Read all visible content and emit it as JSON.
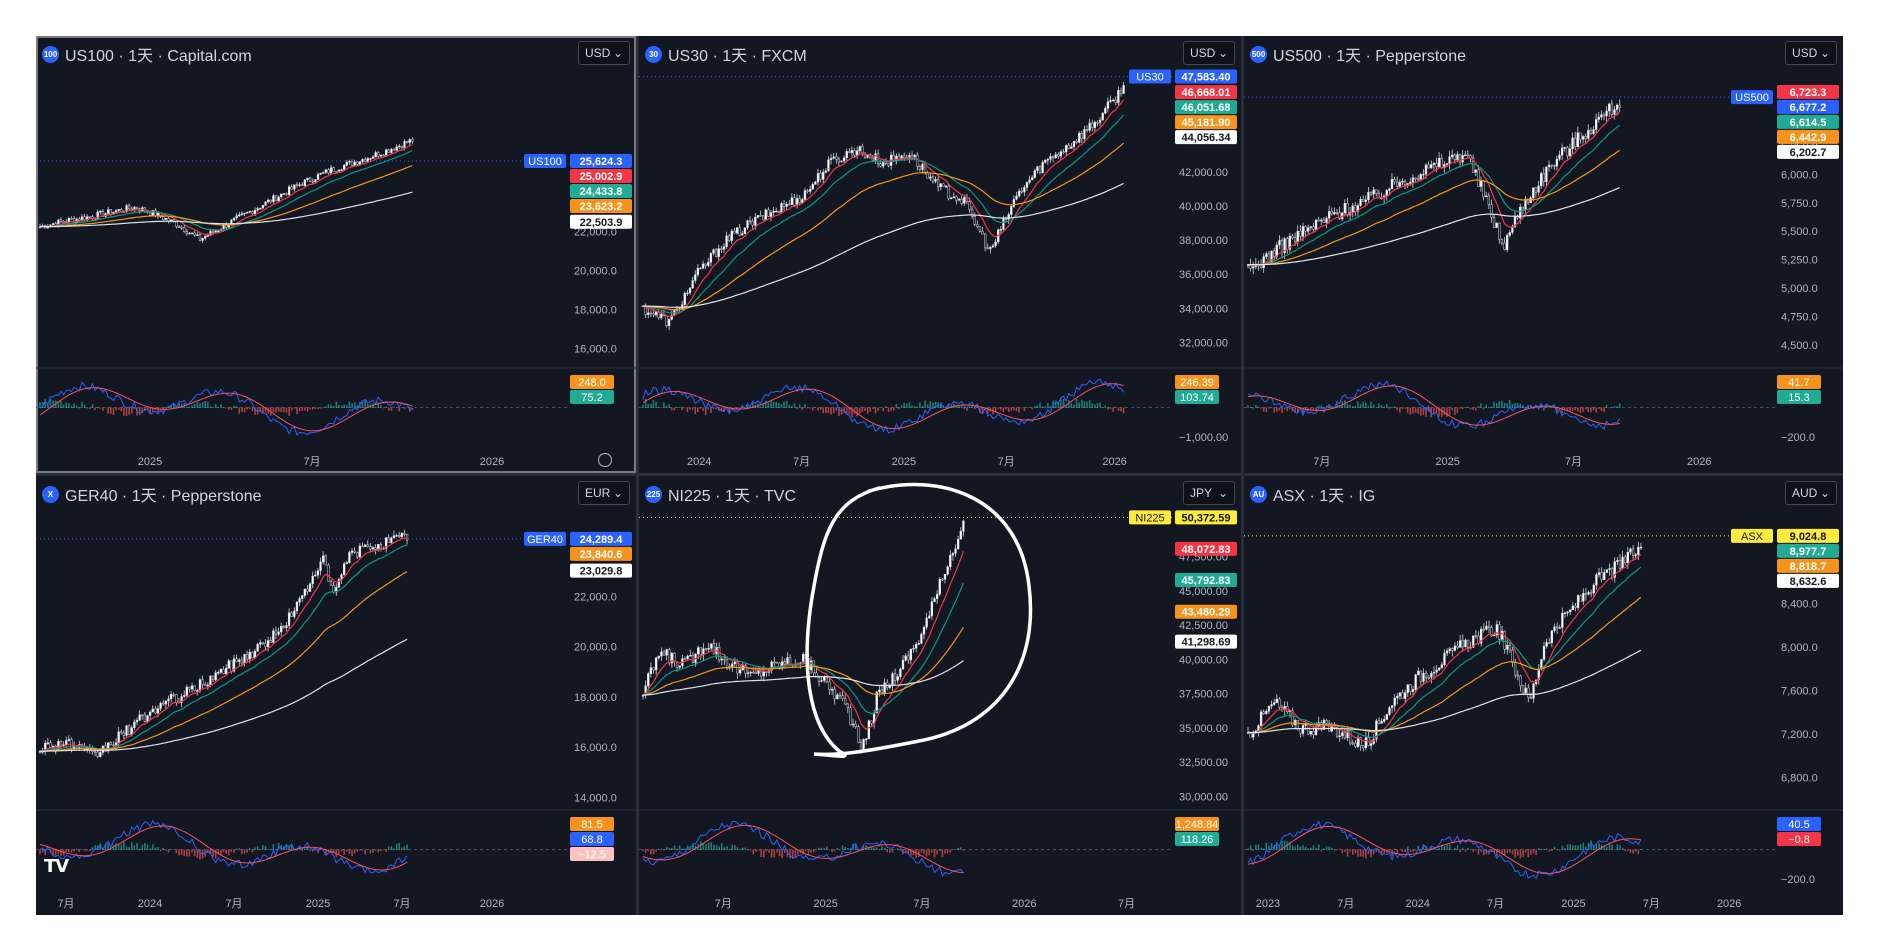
{
  "colors": {
    "background": "#131722",
    "candle": "#d1d4dc",
    "ema_fast": "#f23645",
    "ema_mid": "#089981",
    "ema_slow": "#f7931a",
    "ema_long": "#e0e3eb",
    "grid": "#2a2e39",
    "text": "#b2b5be",
    "macd": "#2962ff",
    "signal": "#f7525f"
  },
  "watermark": "TV",
  "chart_data": [
    {
      "id": "us100",
      "type": "line",
      "title": "US100 · 1天 · Capital.com",
      "icon": "100",
      "currency": "USD",
      "ylim": [
        15000,
        30500
      ],
      "yticks": [
        "16,000.0",
        "18,000.0",
        "20,000.0",
        "22,000.0"
      ],
      "ytick_values": [
        16000,
        18000,
        20000,
        22000
      ],
      "xticks": [
        "2025",
        "7月",
        "2026"
      ],
      "xtick_pos": [
        0.19,
        0.46,
        0.76
      ],
      "symbol_badge": "US100",
      "price_labels": [
        {
          "text": "25,624.3",
          "value": 25624.3,
          "color": "#2962ff",
          "fg": "#ffffff"
        },
        {
          "text": "25,002.9",
          "value": 25002.9,
          "color": "#f23645",
          "fg": "#ffffff"
        },
        {
          "text": "24,433.8",
          "value": 24433.8,
          "color": "#22ab94",
          "fg": "#ffffff"
        },
        {
          "text": "23,623.2",
          "value": 23623.2,
          "color": "#f7931a",
          "fg": "#ffffff"
        },
        {
          "text": "22,503.9",
          "value": 22503.9,
          "color": "#ffffff",
          "fg": "#131722"
        }
      ],
      "osc_labels": [
        {
          "text": "248.0",
          "color": "#f7931a"
        },
        {
          "text": "75.2",
          "color": "#22ab94"
        }
      ],
      "osc_ticks": [],
      "keypoints": [
        [
          0,
          0.52
        ],
        [
          0.05,
          0.62
        ],
        [
          0.1,
          0.7
        ],
        [
          0.14,
          0.78
        ],
        [
          0.18,
          0.85
        ],
        [
          0.22,
          0.72
        ],
        [
          0.26,
          0.55
        ],
        [
          0.3,
          0.3
        ],
        [
          0.34,
          0.5
        ],
        [
          0.38,
          0.7
        ],
        [
          0.43,
          0.95
        ],
        [
          0.49,
          1.25
        ],
        [
          0.55,
          1.5
        ],
        [
          0.61,
          1.68
        ],
        [
          0.66,
          1.85
        ],
        [
          0.7,
          2.0
        ]
      ],
      "xmax": 0.7,
      "start": 20700,
      "scale": 3000
    },
    {
      "id": "us30",
      "type": "line",
      "title": "US30 · 1天 · FXCM",
      "icon": "30",
      "currency": "USD",
      "ylim": [
        30500,
        48200
      ],
      "yticks": [
        "32,000.00",
        "34,000.00",
        "36,000.00",
        "38,000.00",
        "40,000.00",
        "42,000.00",
        "44,056.34"
      ],
      "ytick_values": [
        32000,
        34000,
        36000,
        38000,
        40000,
        42000
      ],
      "xticks": [
        "2024",
        "7月",
        "2025",
        "7月",
        "2026"
      ],
      "xtick_pos": [
        0.1,
        0.27,
        0.44,
        0.61,
        0.79
      ],
      "symbol_badge": "US30",
      "price_labels": [
        {
          "text": "47,583.40",
          "value": 47583.4,
          "color": "#2962ff",
          "fg": "#ffffff"
        },
        {
          "text": "46,668.01",
          "value": 46668.01,
          "color": "#f23645",
          "fg": "#ffffff"
        },
        {
          "text": "46,051.68",
          "value": 46051.68,
          "color": "#22ab94",
          "fg": "#ffffff"
        },
        {
          "text": "45,181.90",
          "value": 45181.9,
          "color": "#f7931a",
          "fg": "#ffffff"
        },
        {
          "text": "44,056.34",
          "value": 44056.34,
          "color": "#ffffff",
          "fg": "#131722"
        }
      ],
      "osc_labels": [
        {
          "text": "246.39",
          "color": "#f7931a"
        },
        {
          "text": "103.74",
          "color": "#22ab94"
        }
      ],
      "osc_ticks": [
        "−1,000.00"
      ],
      "keypoints": [
        [
          0,
          0
        ],
        [
          0.05,
          -0.15
        ],
        [
          0.1,
          0.35
        ],
        [
          0.15,
          0.7
        ],
        [
          0.2,
          0.9
        ],
        [
          0.25,
          1.05
        ],
        [
          0.3,
          1.2
        ],
        [
          0.35,
          1.55
        ],
        [
          0.4,
          1.7
        ],
        [
          0.45,
          1.55
        ],
        [
          0.5,
          1.65
        ],
        [
          0.55,
          1.3
        ],
        [
          0.6,
          1.15
        ],
        [
          0.65,
          0.6
        ],
        [
          0.7,
          1.2
        ],
        [
          0.75,
          1.55
        ],
        [
          0.8,
          1.75
        ],
        [
          0.85,
          2.0
        ],
        [
          0.9,
          2.35
        ]
      ],
      "xmax": 0.9,
      "start": 34000,
      "scale": 5500
    },
    {
      "id": "us500",
      "type": "line",
      "title": "US500 · 1天 · Pepperstone",
      "icon": "500",
      "currency": "USD",
      "ylim": [
        4300,
        6950
      ],
      "yticks": [
        "4,500.0",
        "4,750.0",
        "5,000.0",
        "5,250.0",
        "5,500.0",
        "5,750.0",
        "6,000.0",
        "6,250.0"
      ],
      "ytick_values": [
        4500,
        4750,
        5000,
        5250,
        5500,
        5750,
        6000,
        6250
      ],
      "xticks": [
        "7月",
        "2025",
        "7月",
        "2026"
      ],
      "xtick_pos": [
        0.13,
        0.34,
        0.55,
        0.76
      ],
      "symbol_badge": "US500",
      "price_labels": [
        {
          "text": "6,677.2",
          "value": 6677.2,
          "color": "#2962ff",
          "fg": "#ffffff"
        },
        {
          "text": "6,723.3",
          "value": 6723.3,
          "color": "#f23645",
          "fg": "#ffffff"
        },
        {
          "text": "6,614.5",
          "value": 6614.5,
          "color": "#22ab94",
          "fg": "#ffffff"
        },
        {
          "text": "6,442.9",
          "value": 6442.9,
          "color": "#f7931a",
          "fg": "#ffffff"
        },
        {
          "text": "6,202.7",
          "value": 6202.7,
          "color": "#ffffff",
          "fg": "#131722"
        }
      ],
      "osc_labels": [
        {
          "text": "41.7",
          "color": "#f7931a"
        },
        {
          "text": "15.3",
          "color": "#22ab94"
        }
      ],
      "osc_ticks": [
        "−200.0"
      ],
      "keypoints": [
        [
          0,
          0
        ],
        [
          0.08,
          0.25
        ],
        [
          0.16,
          0.45
        ],
        [
          0.24,
          0.6
        ],
        [
          0.3,
          0.75
        ],
        [
          0.36,
          0.85
        ],
        [
          0.41,
          0.95
        ],
        [
          0.45,
          0.55
        ],
        [
          0.48,
          0.2
        ],
        [
          0.52,
          0.55
        ],
        [
          0.57,
          0.85
        ],
        [
          0.62,
          1.05
        ],
        [
          0.67,
          1.25
        ],
        [
          0.7,
          1.35
        ]
      ],
      "xmax": 0.7,
      "start": 5150,
      "scale": 1100
    },
    {
      "id": "ger40",
      "type": "line",
      "title": "GER40 · 1天 · Pepperstone",
      "icon": "X",
      "currency": "EUR",
      "ylim": [
        13500,
        25600
      ],
      "yticks": [
        "14,000.0",
        "16,000.0",
        "18,000.0",
        "20,000.0",
        "22,000.0"
      ],
      "ytick_values": [
        14000,
        16000,
        18000,
        20000,
        22000
      ],
      "xticks": [
        "7月",
        "2024",
        "7月",
        "2025",
        "7月",
        "2026"
      ],
      "xtick_pos": [
        0.05,
        0.19,
        0.33,
        0.47,
        0.61,
        0.76
      ],
      "symbol_badge": "GER40",
      "price_labels": [
        {
          "text": "24,289.4",
          "value": 24289.4,
          "color": "#2962ff",
          "fg": "#ffffff"
        },
        {
          "text": "23,840.6",
          "value": 23840.6,
          "color": "#f7931a",
          "fg": "#ffffff"
        },
        {
          "text": "23,029.8",
          "value": 23029.8,
          "color": "#ffffff",
          "fg": "#131722"
        }
      ],
      "osc_labels": [
        {
          "text": "81.5",
          "color": "#f7931a"
        },
        {
          "text": "68.8",
          "color": "#2962ff"
        },
        {
          "text": "−12.5",
          "color": "#fbc2c2"
        }
      ],
      "osc_ticks": [],
      "keypoints": [
        [
          0,
          0
        ],
        [
          0.05,
          0.05
        ],
        [
          0.1,
          -0.1
        ],
        [
          0.16,
          0.15
        ],
        [
          0.22,
          0.4
        ],
        [
          0.28,
          0.55
        ],
        [
          0.34,
          0.75
        ],
        [
          0.4,
          0.95
        ],
        [
          0.45,
          1.15
        ],
        [
          0.5,
          1.55
        ],
        [
          0.53,
          1.9
        ],
        [
          0.55,
          1.5
        ],
        [
          0.58,
          1.9
        ],
        [
          0.62,
          2.0
        ],
        [
          0.66,
          2.05
        ],
        [
          0.69,
          2.1
        ]
      ],
      "xmax": 0.69,
      "start": 16000,
      "scale": 4000
    },
    {
      "id": "ni225",
      "type": "line",
      "title": "NI225 · 1天 · TVC",
      "icon": "225",
      "currency": "JPY",
      "ylim": [
        29000,
        51200
      ],
      "yticks": [
        "30,000.00",
        "32,500.00",
        "35,000.00",
        "37,500.00",
        "40,000.00",
        "42,500.00",
        "45,000.00",
        "47,500.00"
      ],
      "ytick_values": [
        30000,
        32500,
        35000,
        37500,
        40000,
        42500,
        45000,
        47500
      ],
      "xticks": [
        "7月",
        "2025",
        "7月",
        "2026",
        "7月"
      ],
      "xtick_pos": [
        0.14,
        0.31,
        0.47,
        0.64,
        0.81
      ],
      "symbol_badge": "NI225",
      "price_labels": [
        {
          "text": "50,372.59",
          "value": 50372.59,
          "color": "#ffeb3b",
          "fg": "#131722"
        },
        {
          "text": "48,072.83",
          "value": 48072.83,
          "color": "#f23645",
          "fg": "#ffffff"
        },
        {
          "text": "45,792.83",
          "value": 45792.83,
          "color": "#22ab94",
          "fg": "#ffffff"
        },
        {
          "text": "43,480.29",
          "value": 43480.29,
          "color": "#f7931a",
          "fg": "#ffffff"
        },
        {
          "text": "41,298.69",
          "value": 41298.69,
          "color": "#ffffff",
          "fg": "#131722"
        }
      ],
      "osc_labels": [
        {
          "text": "1,248.84",
          "color": "#f7931a"
        },
        {
          "text": "118.26",
          "color": "#22ab94"
        }
      ],
      "osc_ticks": [],
      "keypoints": [
        [
          0,
          0
        ],
        [
          0.03,
          0.35
        ],
        [
          0.08,
          0.25
        ],
        [
          0.12,
          0.45
        ],
        [
          0.15,
          0.3
        ],
        [
          0.2,
          0.15
        ],
        [
          0.25,
          0.25
        ],
        [
          0.3,
          0.3
        ],
        [
          0.34,
          0.1
        ],
        [
          0.38,
          -0.1
        ],
        [
          0.41,
          -0.5
        ],
        [
          0.44,
          0.0
        ],
        [
          0.48,
          0.2
        ],
        [
          0.52,
          0.5
        ],
        [
          0.55,
          0.85
        ],
        [
          0.58,
          1.25
        ],
        [
          0.6,
          1.45
        ]
      ],
      "xmax": 0.6,
      "start": 37500,
      "scale": 8500
    },
    {
      "id": "asx",
      "type": "line",
      "title": "ASX · 1天 · IG",
      "icon": "AU",
      "currency": "AUD",
      "ylim": [
        6500,
        9300
      ],
      "yticks": [
        "6,800.0",
        "7,200.0",
        "7,600.0",
        "8,000.0",
        "8,400.0"
      ],
      "ytick_values": [
        6800,
        7200,
        7600,
        8000,
        8400
      ],
      "xticks": [
        "2023",
        "7月",
        "2024",
        "7月",
        "2025",
        "7月",
        "2026"
      ],
      "xtick_pos": [
        0.04,
        0.17,
        0.29,
        0.42,
        0.55,
        0.68,
        0.81
      ],
      "symbol_badge": "ASX",
      "price_labels": [
        {
          "text": "9,024.8",
          "value": 9024.8,
          "color": "#ffeb3b",
          "fg": "#131722"
        },
        {
          "text": "8,977.7",
          "value": 8977.7,
          "color": "#22ab94",
          "fg": "#ffffff"
        },
        {
          "text": "8,818.7",
          "value": 8818.7,
          "color": "#f7931a",
          "fg": "#ffffff"
        },
        {
          "text": "8,632.6",
          "value": 8632.6,
          "color": "#ffffff",
          "fg": "#131722"
        }
      ],
      "osc_labels": [
        {
          "text": "40.5",
          "color": "#2962ff"
        },
        {
          "text": "−0.8",
          "color": "#f23645"
        }
      ],
      "osc_ticks": [
        "−200.0"
      ],
      "keypoints": [
        [
          0,
          0
        ],
        [
          0.05,
          0.25
        ],
        [
          0.1,
          0.05
        ],
        [
          0.16,
          0.05
        ],
        [
          0.22,
          -0.1
        ],
        [
          0.27,
          0.25
        ],
        [
          0.32,
          0.45
        ],
        [
          0.37,
          0.6
        ],
        [
          0.42,
          0.75
        ],
        [
          0.47,
          0.85
        ],
        [
          0.5,
          0.55
        ],
        [
          0.53,
          0.25
        ],
        [
          0.56,
          0.75
        ],
        [
          0.6,
          0.95
        ],
        [
          0.65,
          1.2
        ],
        [
          0.7,
          1.35
        ],
        [
          0.74,
          1.5
        ]
      ],
      "xmax": 0.74,
      "start": 7200,
      "scale": 1150
    }
  ]
}
